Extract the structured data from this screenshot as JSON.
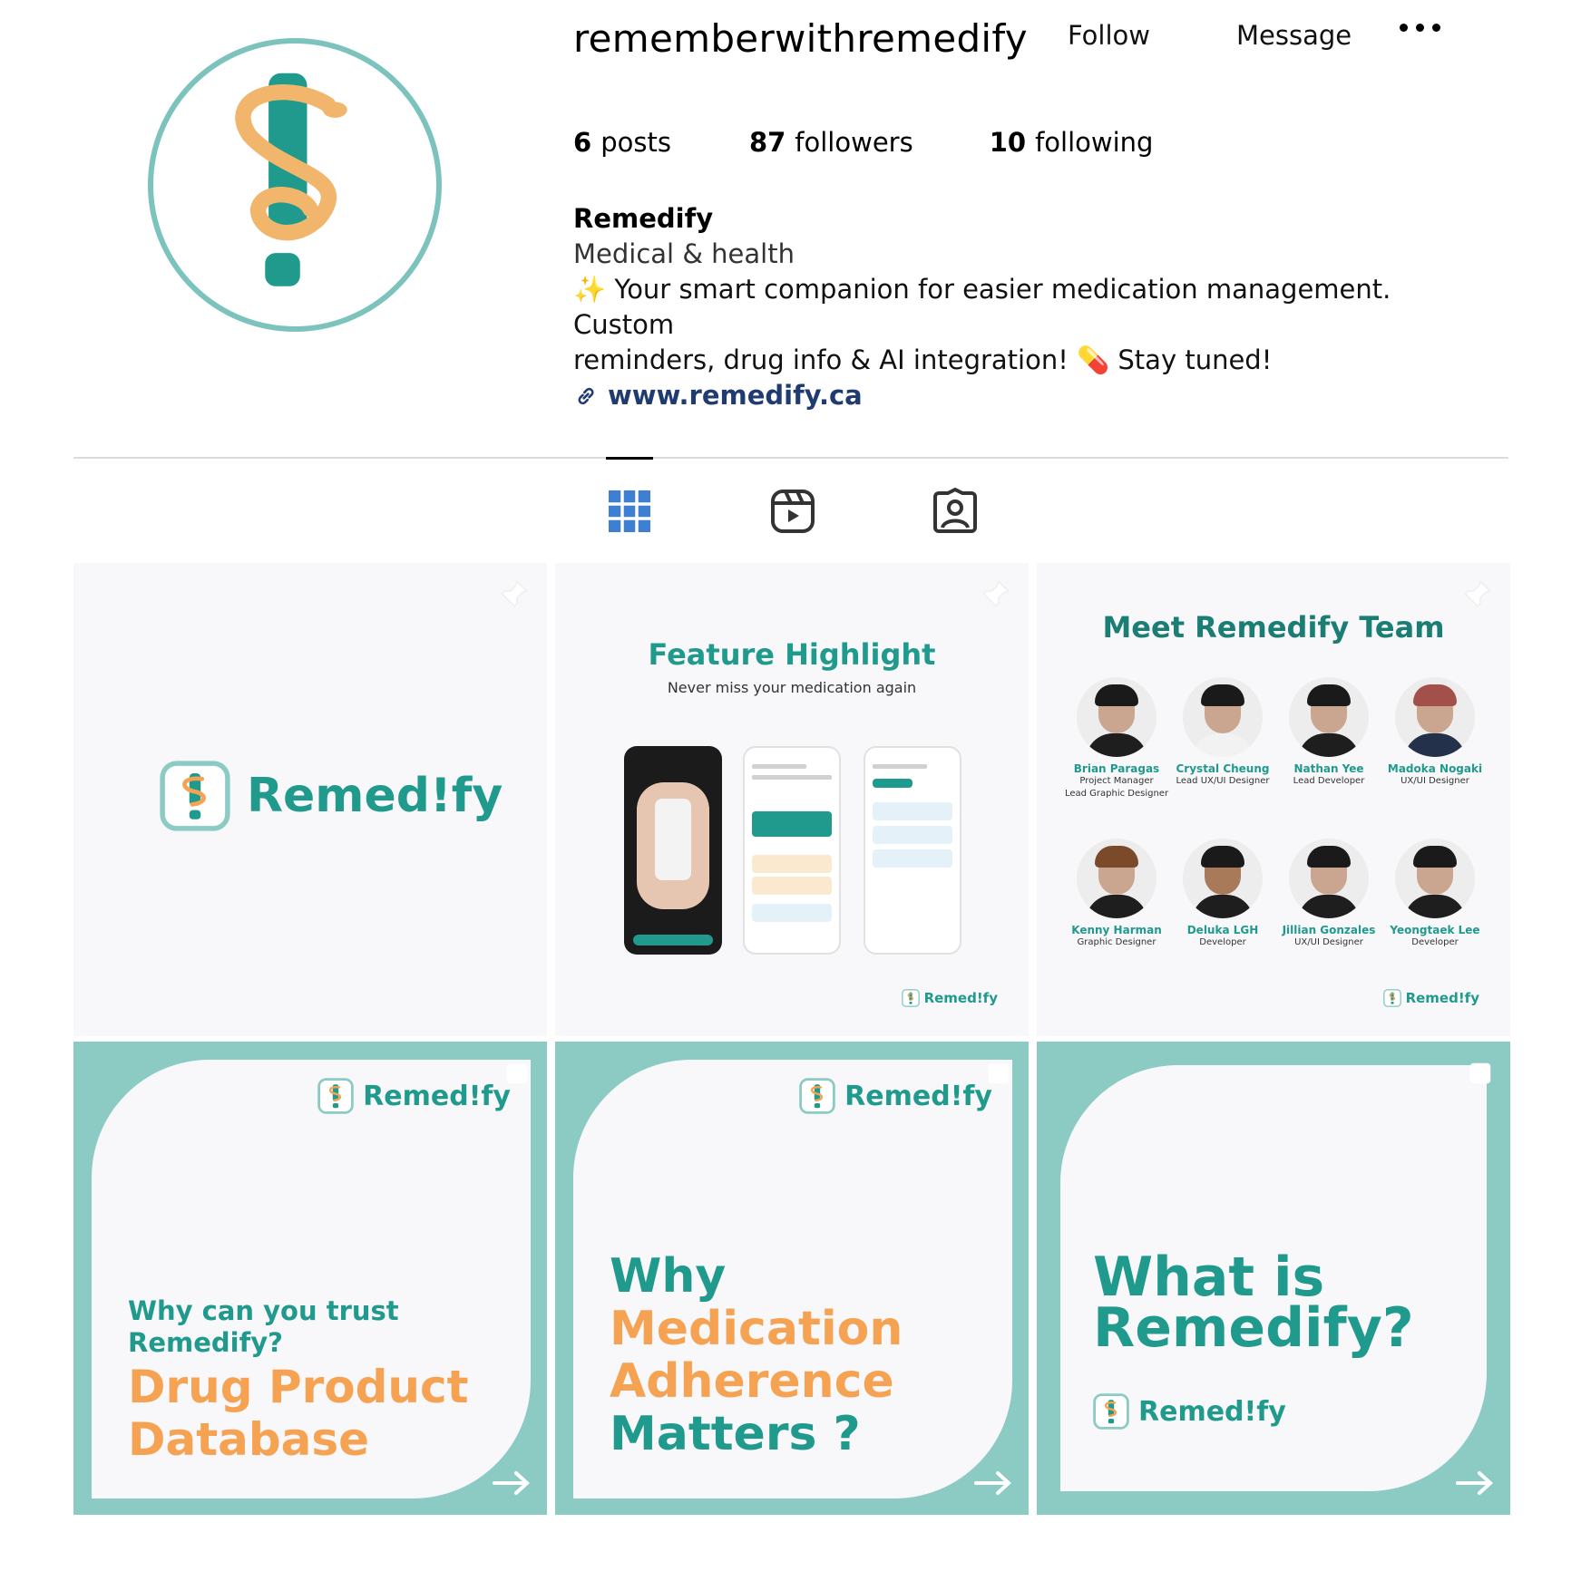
{
  "profile": {
    "username": "rememberwithremedify",
    "follow_label": "Follow",
    "message_label": "Message",
    "more_icon": "more-options-icon",
    "stats": {
      "posts_count": "6",
      "posts_label": "posts",
      "followers_count": "87",
      "followers_label": "followers",
      "following_count": "10",
      "following_label": "following"
    },
    "bio": {
      "name": "Remedify",
      "category": "Medical & health",
      "line1": "✨ Your smart companion for easier medication management. Custom",
      "line2": "reminders, drug info & AI integration! 💊 Stay tuned!",
      "link": "www.remedify.ca"
    }
  },
  "tabs": [
    {
      "name": "posts",
      "icon": "grid-icon",
      "active": true
    },
    {
      "name": "reels",
      "icon": "reels-icon",
      "active": false
    },
    {
      "name": "tagged",
      "icon": "tagged-icon",
      "active": false
    }
  ],
  "colors": {
    "teal": "#1f9a8d",
    "orange": "#f5a352",
    "light_teal": "#8ccbc4",
    "link_blue": "#1f3b70"
  },
  "posts": {
    "p1": {
      "brand": "Remed!fy"
    },
    "p2": {
      "title": "Feature Highlight",
      "subtitle": "Never miss your medication again",
      "brand": "Remed!fy"
    },
    "p3": {
      "title": "Meet Remedify Team",
      "brand": "Remed!fy",
      "members": [
        {
          "name": "Brian Paragas",
          "role1": "Project Manager",
          "role2": "Lead Graphic Designer"
        },
        {
          "name": "Crystal Cheung",
          "role1": "Lead UX/UI Designer",
          "role2": ""
        },
        {
          "name": "Nathan Yee",
          "role1": "Lead Developer",
          "role2": ""
        },
        {
          "name": "Madoka Nogaki",
          "role1": "UX/UI Designer",
          "role2": ""
        },
        {
          "name": "Kenny Harman",
          "role1": "Graphic Designer",
          "role2": ""
        },
        {
          "name": "Deluka LGH",
          "role1": "Developer",
          "role2": ""
        },
        {
          "name": "Jillian Gonzales",
          "role1": "UX/UI Designer",
          "role2": ""
        },
        {
          "name": "Yeongtaek Lee",
          "role1": "Developer",
          "role2": ""
        }
      ]
    },
    "p4": {
      "brand": "Remed!fy",
      "question_line1": "Why can you trust",
      "question_line2": "Remedify?",
      "big_line1": "Drug Product",
      "big_line2": "Database"
    },
    "p5": {
      "brand": "Remed!fy",
      "line1": "Why",
      "line2": "Medication",
      "line3": "Adherence",
      "line4": "Matters ?"
    },
    "p6": {
      "brand": "Remed!fy",
      "line1": "What is",
      "line2": "Remedify?"
    }
  }
}
